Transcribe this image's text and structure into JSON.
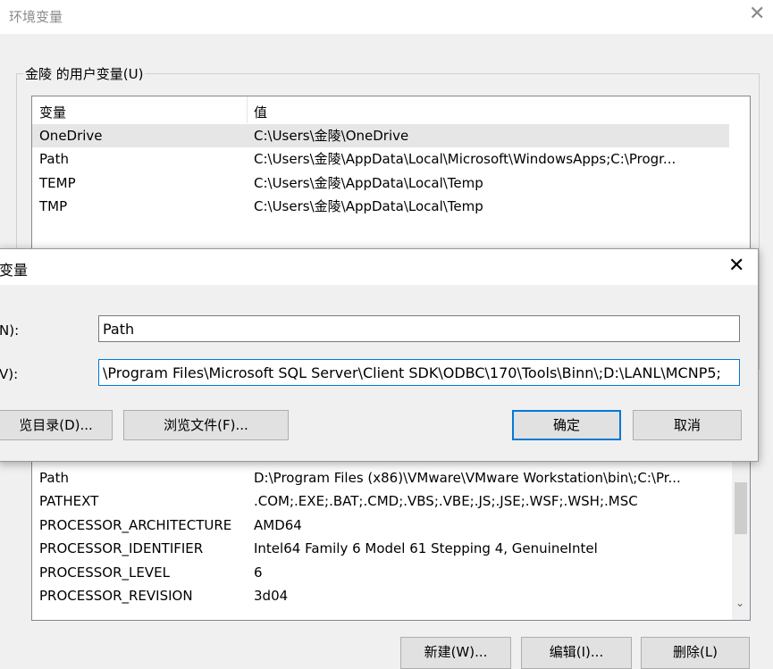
{
  "window": {
    "title": "环境变量",
    "close_glyph": "✕"
  },
  "user_vars": {
    "group_label": "金陵 的用户变量(U)",
    "columns": [
      "变量",
      "值"
    ],
    "rows": [
      {
        "name": "OneDrive",
        "value": "C:\\Users\\金陵\\OneDrive"
      },
      {
        "name": "Path",
        "value": "C:\\Users\\金陵\\AppData\\Local\\Microsoft\\WindowsApps;C:\\Progr..."
      },
      {
        "name": "TEMP",
        "value": "C:\\Users\\金陵\\AppData\\Local\\Temp"
      },
      {
        "name": "TMP",
        "value": "C:\\Users\\金陵\\AppData\\Local\\Temp"
      }
    ]
  },
  "dialog": {
    "title": "变量",
    "close_glyph": "✕",
    "name_label": "N):",
    "name_value": "Path",
    "value_label": "V):",
    "value_value": "\\Program Files\\Microsoft SQL Server\\Client SDK\\ODBC\\170\\Tools\\Binn\\;D:\\LANL\\MCNP5;",
    "browse_dir": "览目录(D)...",
    "browse_file": "浏览文件(F)...",
    "ok": "确定",
    "cancel": "取消"
  },
  "system_vars": {
    "rows": [
      {
        "name": "Path",
        "value": "D:\\Program Files (x86)\\VMware\\VMware Workstation\\bin\\;C:\\Pr..."
      },
      {
        "name": "PATHEXT",
        "value": ".COM;.EXE;.BAT;.CMD;.VBS;.VBE;.JS;.JSE;.WSF;.WSH;.MSC"
      },
      {
        "name": "PROCESSOR_ARCHITECTURE",
        "value": "AMD64"
      },
      {
        "name": "PROCESSOR_IDENTIFIER",
        "value": "Intel64 Family 6 Model 61 Stepping 4, GenuineIntel"
      },
      {
        "name": "PROCESSOR_LEVEL",
        "value": "6"
      },
      {
        "name": "PROCESSOR_REVISION",
        "value": "3d04"
      }
    ],
    "scroll_down_glyph": "⌄"
  },
  "bottom_buttons": {
    "new": "新建(W)...",
    "edit": "编辑(I)...",
    "delete": "删除(L)"
  }
}
